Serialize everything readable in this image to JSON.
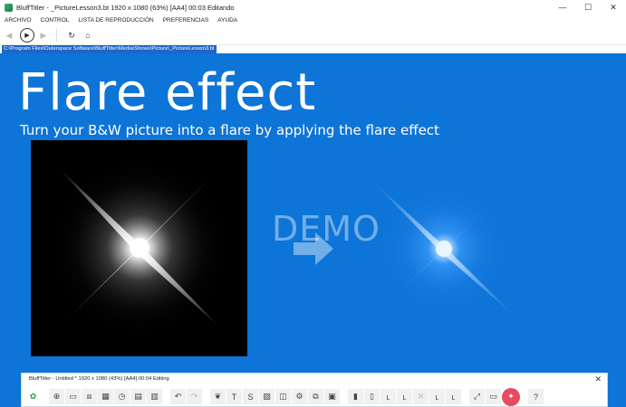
{
  "window": {
    "title": "BluffTitler - _PictureLesson3.bt 1920 x 1080 (63%) [AA4] 00:03 Editando",
    "minimize": "—",
    "maximize": "☐",
    "close": "✕"
  },
  "menu": {
    "items": [
      "ARCHIVO",
      "CONTROL",
      "LISTA DE REPRODUCCIÓN",
      "PREFERENCIAS",
      "AYUDA"
    ]
  },
  "nav": {
    "back": "◀",
    "play": "▶",
    "forward": "▶",
    "refresh": "↻",
    "home": "⌂"
  },
  "path": {
    "text": "C:\\Program Files\\Outerspace Software\\BluffTitler\\Media\\Shows\\Picture\\_PictureLesson3.bt"
  },
  "stage": {
    "headline": "Flare effect",
    "subline": "Turn your B&W picture into a flare by applying the flare effect",
    "watermark": "DEMO",
    "colors": {
      "background": "#0d74d8",
      "flare_core": "#ffffff",
      "flare_blue": "#3fa0ff"
    }
  },
  "tool_panel": {
    "title": "BluffTitler - Untitled * 1920 x 1080 (43%) [AA4] 00:04 Editing",
    "close": "✕",
    "buttons": [
      {
        "icon": "logo-icon",
        "glyph": "✿"
      },
      {
        "icon": "add-layer-icon",
        "glyph": "⊕"
      },
      {
        "icon": "open-folder-icon",
        "glyph": "▭"
      },
      {
        "icon": "frame-icon",
        "glyph": "⧈"
      },
      {
        "icon": "media-icon",
        "glyph": "▦"
      },
      {
        "icon": "clock-icon",
        "glyph": "◷"
      },
      {
        "icon": "save-icon",
        "glyph": "▤"
      },
      {
        "icon": "film-icon",
        "glyph": "▥"
      },
      {
        "icon": "undo-icon",
        "glyph": "↶"
      },
      {
        "icon": "redo-icon",
        "glyph": "↷"
      },
      {
        "icon": "paint-icon",
        "glyph": "❦"
      },
      {
        "icon": "text-icon",
        "glyph": "T"
      },
      {
        "icon": "subscript-text-icon",
        "glyph": "S"
      },
      {
        "icon": "picture-icon",
        "glyph": "▨"
      },
      {
        "icon": "cube-icon",
        "glyph": "◫"
      },
      {
        "icon": "settings-icon",
        "glyph": "⚙"
      },
      {
        "icon": "link-icon",
        "glyph": "⧉"
      },
      {
        "icon": "layer-list-icon",
        "glyph": "▣"
      },
      {
        "icon": "align-icon",
        "glyph": "▮"
      },
      {
        "icon": "align-distribute-icon",
        "glyph": "▯"
      },
      {
        "icon": "parent-icon",
        "glyph": "ʟ"
      },
      {
        "icon": "child-icon",
        "glyph": "ʟ"
      },
      {
        "icon": "cross-dim-icon",
        "glyph": "✕"
      },
      {
        "icon": "link-text-icon",
        "glyph": "ʟ"
      },
      {
        "icon": "chain-icon",
        "glyph": "ʟ"
      },
      {
        "icon": "resize-icon",
        "glyph": "⤢"
      },
      {
        "icon": "preview-icon",
        "glyph": "▭"
      },
      {
        "icon": "magic-icon",
        "glyph": "✦"
      },
      {
        "icon": "help-icon",
        "glyph": "?"
      }
    ]
  }
}
